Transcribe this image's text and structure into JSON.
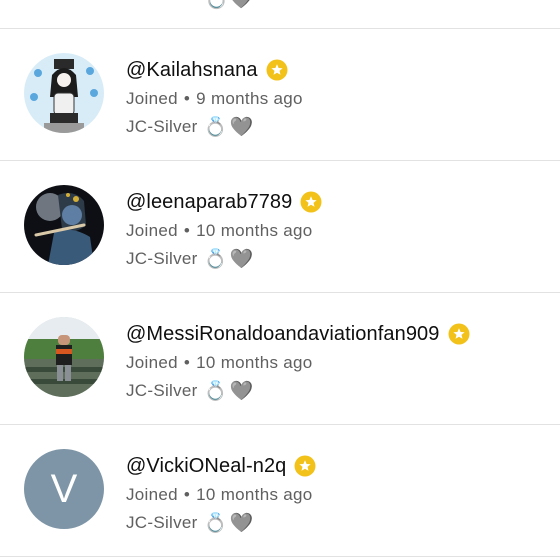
{
  "top_partial": {
    "ring_icon": "💍",
    "heart_icon": "🩶"
  },
  "members": [
    {
      "handle": "@Kailahsnana",
      "joined": "Joined",
      "separator": "•",
      "joined_time": "9 months ago",
      "level": "JC-Silver",
      "avatar_icon": "anime-girl-avatar",
      "ring_icon": "💍",
      "heart_icon": "🩶"
    },
    {
      "handle": "@leenaparab7789",
      "joined": "Joined",
      "separator": "•",
      "joined_time": "10 months ago",
      "level": "JC-Silver",
      "avatar_icon": "krishna-flute-avatar",
      "ring_icon": "💍",
      "heart_icon": "🩶"
    },
    {
      "handle": "@MessiRonaldoandaviationfan909",
      "joined": "Joined",
      "separator": "•",
      "joined_time": "10 months ago",
      "level": "JC-Silver",
      "avatar_icon": "stadium-photo-avatar",
      "ring_icon": "💍",
      "heart_icon": "🩶"
    },
    {
      "handle": "@VickiONeal-n2q",
      "joined": "Joined",
      "separator": "•",
      "joined_time": "10 months ago",
      "level": "JC-Silver",
      "avatar_letter": "V",
      "avatar_icon": "letter-avatar",
      "ring_icon": "💍",
      "heart_icon": "🩶"
    }
  ],
  "colors": {
    "verified_badge": "#f2c21b",
    "secondary_text": "#606060",
    "letter_avatar_bg": "#7d95a6",
    "divider": "#e2e2e2"
  }
}
